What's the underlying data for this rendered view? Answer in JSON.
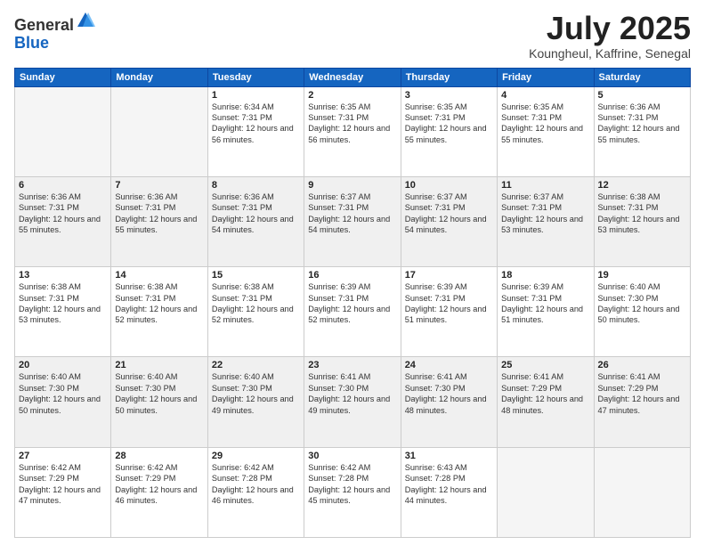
{
  "logo": {
    "general": "General",
    "blue": "Blue"
  },
  "title": {
    "month_year": "July 2025",
    "location": "Koungheul, Kaffrine, Senegal"
  },
  "days_of_week": [
    "Sunday",
    "Monday",
    "Tuesday",
    "Wednesday",
    "Thursday",
    "Friday",
    "Saturday"
  ],
  "weeks": [
    [
      {
        "day": null,
        "sunrise": null,
        "sunset": null,
        "daylight": null
      },
      {
        "day": null,
        "sunrise": null,
        "sunset": null,
        "daylight": null
      },
      {
        "day": 1,
        "sunrise": "Sunrise: 6:34 AM",
        "sunset": "Sunset: 7:31 PM",
        "daylight": "Daylight: 12 hours and 56 minutes."
      },
      {
        "day": 2,
        "sunrise": "Sunrise: 6:35 AM",
        "sunset": "Sunset: 7:31 PM",
        "daylight": "Daylight: 12 hours and 56 minutes."
      },
      {
        "day": 3,
        "sunrise": "Sunrise: 6:35 AM",
        "sunset": "Sunset: 7:31 PM",
        "daylight": "Daylight: 12 hours and 55 minutes."
      },
      {
        "day": 4,
        "sunrise": "Sunrise: 6:35 AM",
        "sunset": "Sunset: 7:31 PM",
        "daylight": "Daylight: 12 hours and 55 minutes."
      },
      {
        "day": 5,
        "sunrise": "Sunrise: 6:36 AM",
        "sunset": "Sunset: 7:31 PM",
        "daylight": "Daylight: 12 hours and 55 minutes."
      }
    ],
    [
      {
        "day": 6,
        "sunrise": "Sunrise: 6:36 AM",
        "sunset": "Sunset: 7:31 PM",
        "daylight": "Daylight: 12 hours and 55 minutes."
      },
      {
        "day": 7,
        "sunrise": "Sunrise: 6:36 AM",
        "sunset": "Sunset: 7:31 PM",
        "daylight": "Daylight: 12 hours and 55 minutes."
      },
      {
        "day": 8,
        "sunrise": "Sunrise: 6:36 AM",
        "sunset": "Sunset: 7:31 PM",
        "daylight": "Daylight: 12 hours and 54 minutes."
      },
      {
        "day": 9,
        "sunrise": "Sunrise: 6:37 AM",
        "sunset": "Sunset: 7:31 PM",
        "daylight": "Daylight: 12 hours and 54 minutes."
      },
      {
        "day": 10,
        "sunrise": "Sunrise: 6:37 AM",
        "sunset": "Sunset: 7:31 PM",
        "daylight": "Daylight: 12 hours and 54 minutes."
      },
      {
        "day": 11,
        "sunrise": "Sunrise: 6:37 AM",
        "sunset": "Sunset: 7:31 PM",
        "daylight": "Daylight: 12 hours and 53 minutes."
      },
      {
        "day": 12,
        "sunrise": "Sunrise: 6:38 AM",
        "sunset": "Sunset: 7:31 PM",
        "daylight": "Daylight: 12 hours and 53 minutes."
      }
    ],
    [
      {
        "day": 13,
        "sunrise": "Sunrise: 6:38 AM",
        "sunset": "Sunset: 7:31 PM",
        "daylight": "Daylight: 12 hours and 53 minutes."
      },
      {
        "day": 14,
        "sunrise": "Sunrise: 6:38 AM",
        "sunset": "Sunset: 7:31 PM",
        "daylight": "Daylight: 12 hours and 52 minutes."
      },
      {
        "day": 15,
        "sunrise": "Sunrise: 6:38 AM",
        "sunset": "Sunset: 7:31 PM",
        "daylight": "Daylight: 12 hours and 52 minutes."
      },
      {
        "day": 16,
        "sunrise": "Sunrise: 6:39 AM",
        "sunset": "Sunset: 7:31 PM",
        "daylight": "Daylight: 12 hours and 52 minutes."
      },
      {
        "day": 17,
        "sunrise": "Sunrise: 6:39 AM",
        "sunset": "Sunset: 7:31 PM",
        "daylight": "Daylight: 12 hours and 51 minutes."
      },
      {
        "day": 18,
        "sunrise": "Sunrise: 6:39 AM",
        "sunset": "Sunset: 7:31 PM",
        "daylight": "Daylight: 12 hours and 51 minutes."
      },
      {
        "day": 19,
        "sunrise": "Sunrise: 6:40 AM",
        "sunset": "Sunset: 7:30 PM",
        "daylight": "Daylight: 12 hours and 50 minutes."
      }
    ],
    [
      {
        "day": 20,
        "sunrise": "Sunrise: 6:40 AM",
        "sunset": "Sunset: 7:30 PM",
        "daylight": "Daylight: 12 hours and 50 minutes."
      },
      {
        "day": 21,
        "sunrise": "Sunrise: 6:40 AM",
        "sunset": "Sunset: 7:30 PM",
        "daylight": "Daylight: 12 hours and 50 minutes."
      },
      {
        "day": 22,
        "sunrise": "Sunrise: 6:40 AM",
        "sunset": "Sunset: 7:30 PM",
        "daylight": "Daylight: 12 hours and 49 minutes."
      },
      {
        "day": 23,
        "sunrise": "Sunrise: 6:41 AM",
        "sunset": "Sunset: 7:30 PM",
        "daylight": "Daylight: 12 hours and 49 minutes."
      },
      {
        "day": 24,
        "sunrise": "Sunrise: 6:41 AM",
        "sunset": "Sunset: 7:30 PM",
        "daylight": "Daylight: 12 hours and 48 minutes."
      },
      {
        "day": 25,
        "sunrise": "Sunrise: 6:41 AM",
        "sunset": "Sunset: 7:29 PM",
        "daylight": "Daylight: 12 hours and 48 minutes."
      },
      {
        "day": 26,
        "sunrise": "Sunrise: 6:41 AM",
        "sunset": "Sunset: 7:29 PM",
        "daylight": "Daylight: 12 hours and 47 minutes."
      }
    ],
    [
      {
        "day": 27,
        "sunrise": "Sunrise: 6:42 AM",
        "sunset": "Sunset: 7:29 PM",
        "daylight": "Daylight: 12 hours and 47 minutes."
      },
      {
        "day": 28,
        "sunrise": "Sunrise: 6:42 AM",
        "sunset": "Sunset: 7:29 PM",
        "daylight": "Daylight: 12 hours and 46 minutes."
      },
      {
        "day": 29,
        "sunrise": "Sunrise: 6:42 AM",
        "sunset": "Sunset: 7:28 PM",
        "daylight": "Daylight: 12 hours and 46 minutes."
      },
      {
        "day": 30,
        "sunrise": "Sunrise: 6:42 AM",
        "sunset": "Sunset: 7:28 PM",
        "daylight": "Daylight: 12 hours and 45 minutes."
      },
      {
        "day": 31,
        "sunrise": "Sunrise: 6:43 AM",
        "sunset": "Sunset: 7:28 PM",
        "daylight": "Daylight: 12 hours and 44 minutes."
      },
      {
        "day": null,
        "sunrise": null,
        "sunset": null,
        "daylight": null
      },
      {
        "day": null,
        "sunrise": null,
        "sunset": null,
        "daylight": null
      }
    ]
  ]
}
